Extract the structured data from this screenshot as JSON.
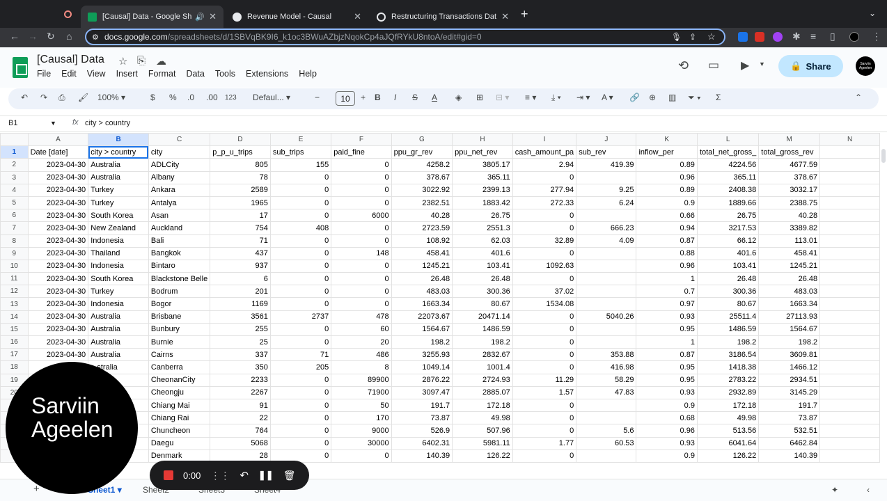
{
  "browser": {
    "tabs": [
      {
        "title": "[Causal] Data - Google Sh",
        "active": true
      },
      {
        "title": "Revenue Model - Causal",
        "active": false
      },
      {
        "title": "Restructuring Transactions Dat",
        "active": false
      }
    ],
    "new_tab": "+",
    "url_host": "docs.google.com",
    "url_path": "/spreadsheets/d/1SBVqBK9I6_k1oc3BWuAZbjzNqokCp4aJQfRYkU8ntoA/edit#gid=0"
  },
  "sheets": {
    "title": "[Causal] Data",
    "menu": [
      "File",
      "Edit",
      "View",
      "Insert",
      "Format",
      "Data",
      "Tools",
      "Extensions",
      "Help"
    ],
    "share_label": "Share",
    "avatar_text": "Sarviin Ageelen",
    "toolbar": {
      "zoom": "100%",
      "currency": "$",
      "percent": "%",
      "dec_minus": ".0",
      "dec_plus": ".00",
      "num_format": "123",
      "font": "Defaul...",
      "font_size": "10"
    },
    "formula": {
      "cell_ref": "B1",
      "fx": "fx",
      "value": "city > country"
    },
    "columns": [
      "A",
      "B",
      "C",
      "D",
      "E",
      "F",
      "G",
      "H",
      "I",
      "J",
      "K",
      "L",
      "M",
      "N"
    ],
    "rows": [
      [
        "1",
        "Date [date]",
        "city > country",
        "city",
        "p_p_u_trips",
        "sub_trips",
        "paid_fine",
        "ppu_gr_rev",
        "ppu_net_rev",
        "cash_amount_pa",
        "sub_rev",
        "inflow_per",
        "total_net_gross_",
        "total_gross_rev",
        ""
      ],
      [
        "2",
        "2023-04-30",
        "Australia",
        "ADLCity",
        "805",
        "155",
        "0",
        "4258.2",
        "3805.17",
        "2.94",
        "419.39",
        "0.89",
        "4224.56",
        "4677.59",
        ""
      ],
      [
        "3",
        "2023-04-30",
        "Australia",
        "Albany",
        "78",
        "0",
        "0",
        "378.67",
        "365.11",
        "0",
        "",
        "0.96",
        "365.11",
        "378.67",
        ""
      ],
      [
        "4",
        "2023-04-30",
        "Turkey",
        "Ankara",
        "2589",
        "0",
        "0",
        "3022.92",
        "2399.13",
        "277.94",
        "9.25",
        "0.89",
        "2408.38",
        "3032.17",
        ""
      ],
      [
        "5",
        "2023-04-30",
        "Turkey",
        "Antalya",
        "1965",
        "0",
        "0",
        "2382.51",
        "1883.42",
        "272.33",
        "6.24",
        "0.9",
        "1889.66",
        "2388.75",
        ""
      ],
      [
        "6",
        "2023-04-30",
        "South Korea",
        "Asan",
        "17",
        "0",
        "6000",
        "40.28",
        "26.75",
        "0",
        "",
        "0.66",
        "26.75",
        "40.28",
        ""
      ],
      [
        "7",
        "2023-04-30",
        "New Zealand",
        "Auckland",
        "754",
        "408",
        "0",
        "2723.59",
        "2551.3",
        "0",
        "666.23",
        "0.94",
        "3217.53",
        "3389.82",
        ""
      ],
      [
        "8",
        "2023-04-30",
        "Indonesia",
        "Bali",
        "71",
        "0",
        "0",
        "108.92",
        "62.03",
        "32.89",
        "4.09",
        "0.87",
        "66.12",
        "113.01",
        ""
      ],
      [
        "9",
        "2023-04-30",
        "Thailand",
        "Bangkok",
        "437",
        "0",
        "148",
        "458.41",
        "401.6",
        "0",
        "",
        "0.88",
        "401.6",
        "458.41",
        ""
      ],
      [
        "10",
        "2023-04-30",
        "Indonesia",
        "Bintaro",
        "937",
        "0",
        "0",
        "1245.21",
        "103.41",
        "1092.63",
        "",
        "0.96",
        "103.41",
        "1245.21",
        ""
      ],
      [
        "11",
        "2023-04-30",
        "South Korea",
        "Blackstone Belle",
        "6",
        "0",
        "0",
        "26.48",
        "26.48",
        "0",
        "",
        "1",
        "26.48",
        "26.48",
        ""
      ],
      [
        "12",
        "2023-04-30",
        "Turkey",
        "Bodrum",
        "201",
        "0",
        "0",
        "483.03",
        "300.36",
        "37.02",
        "",
        "0.7",
        "300.36",
        "483.03",
        ""
      ],
      [
        "13",
        "2023-04-30",
        "Indonesia",
        "Bogor",
        "1169",
        "0",
        "0",
        "1663.34",
        "80.67",
        "1534.08",
        "",
        "0.97",
        "80.67",
        "1663.34",
        ""
      ],
      [
        "14",
        "2023-04-30",
        "Australia",
        "Brisbane",
        "3561",
        "2737",
        "478",
        "22073.67",
        "20471.14",
        "0",
        "5040.26",
        "0.93",
        "25511.4",
        "27113.93",
        ""
      ],
      [
        "15",
        "2023-04-30",
        "Australia",
        "Bunbury",
        "255",
        "0",
        "60",
        "1564.67",
        "1486.59",
        "0",
        "",
        "0.95",
        "1486.59",
        "1564.67",
        ""
      ],
      [
        "16",
        "2023-04-30",
        "Australia",
        "Burnie",
        "25",
        "0",
        "20",
        "198.2",
        "198.2",
        "0",
        "",
        "1",
        "198.2",
        "198.2",
        ""
      ],
      [
        "17",
        "2023-04-30",
        "Australia",
        "Cairns",
        "337",
        "71",
        "486",
        "3255.93",
        "2832.67",
        "0",
        "353.88",
        "0.87",
        "3186.54",
        "3609.81",
        ""
      ],
      [
        "18",
        "",
        "...stralia",
        "Canberra",
        "350",
        "205",
        "8",
        "1049.14",
        "1001.4",
        "0",
        "416.98",
        "0.95",
        "1418.38",
        "1466.12",
        ""
      ],
      [
        "19",
        "",
        "...orea",
        "CheonanCity",
        "2233",
        "0",
        "89900",
        "2876.22",
        "2724.93",
        "11.29",
        "58.29",
        "0.95",
        "2783.22",
        "2934.51",
        ""
      ],
      [
        "20",
        "",
        "",
        "Cheongju",
        "2267",
        "0",
        "71900",
        "3097.47",
        "2885.07",
        "1.57",
        "47.83",
        "0.93",
        "2932.89",
        "3145.29",
        ""
      ],
      [
        "",
        "",
        "",
        "Chiang Mai",
        "91",
        "0",
        "50",
        "191.7",
        "172.18",
        "0",
        "",
        "0.9",
        "172.18",
        "191.7",
        ""
      ],
      [
        "",
        "",
        "",
        "Chiang Rai",
        "22",
        "0",
        "170",
        "73.87",
        "49.98",
        "0",
        "",
        "0.68",
        "49.98",
        "73.87",
        ""
      ],
      [
        "",
        "",
        "",
        "Chuncheon",
        "764",
        "0",
        "9000",
        "526.9",
        "507.96",
        "0",
        "5.6",
        "0.96",
        "513.56",
        "532.51",
        ""
      ],
      [
        "",
        "",
        "",
        "Daegu",
        "5068",
        "0",
        "30000",
        "6402.31",
        "5981.11",
        "1.77",
        "60.53",
        "0.93",
        "6041.64",
        "6462.84",
        ""
      ],
      [
        "",
        "",
        "",
        "Denmark",
        "28",
        "0",
        "0",
        "140.39",
        "126.22",
        "0",
        "",
        "0.9",
        "126.22",
        "140.39",
        ""
      ]
    ],
    "sheet_tabs": [
      "Sheet1",
      "Sheet2",
      "Sheet3",
      "Sheet4"
    ]
  },
  "overlay": {
    "webcam_name": "Sarviin Ageelen",
    "recorder_time": "0:00"
  }
}
